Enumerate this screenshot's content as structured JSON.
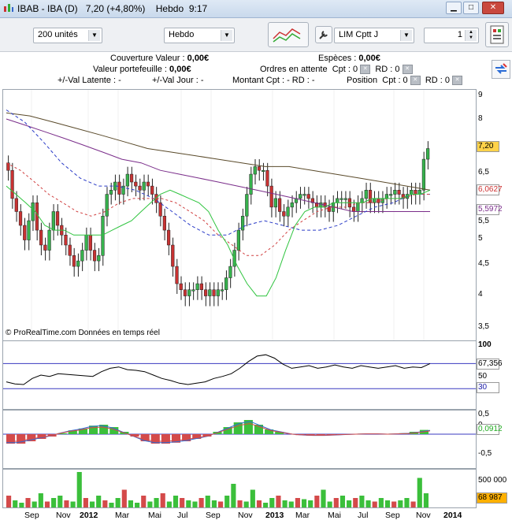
{
  "window": {
    "title_symbol": "IBAB - IBA (D)",
    "title_price": "7,20 (+4,80%)",
    "title_period": "Hebdo",
    "title_time": "9:17"
  },
  "toolbar": {
    "units_select": "200 unités",
    "period_select": "Hebdo",
    "order_type_select": "LIM Cptt J",
    "quantity_value": "1"
  },
  "info": {
    "couverture_label": "Couverture Valeur :",
    "couverture_value": "0,00€",
    "especes_label": "Espèces :",
    "especes_value": "0,00€",
    "portefeuille_label": "Valeur portefeuille :",
    "portefeuille_value": "0,00€",
    "ordres_label": "Ordres en attente",
    "ordres_cpt": "Cpt : 0",
    "ordres_rd": "RD : 0",
    "val_latente": "+/-Val Latente : -",
    "val_jour": "+/-Val Jour : -",
    "montant": "Montant  Cpt : -  RD : -",
    "position_label": "Position",
    "position_cpt": "Cpt : 0",
    "position_rd": "RD : 0"
  },
  "price_axis": {
    "ticks": [
      "9",
      "8",
      "7",
      "6,5",
      "6",
      "5,5",
      "5",
      "4,5",
      "4",
      "3,5"
    ],
    "last_price": "7,20",
    "ma_value_1": "6,0627",
    "ma_value_2": "5,5972",
    "last_price_color": "#ffd24a"
  },
  "rsi_axis": {
    "ticks": [
      "100",
      "50",
      "30"
    ],
    "value": "67,356"
  },
  "macd_axis": {
    "ticks": [
      "0,5",
      "0",
      "-0,5"
    ],
    "value": "0,0912"
  },
  "volume_axis": {
    "ticks": [
      "500 000"
    ],
    "value": "68 987",
    "value_color": "#ffb000"
  },
  "copyright": "© ProRealTime.com  Données en temps réel",
  "x_axis": [
    "Sep",
    "Nov",
    "2012",
    "Mar",
    "Mai",
    "Jul",
    "Sep",
    "Nov",
    "2013",
    "Mar",
    "Mai",
    "Jul",
    "Sep",
    "Nov",
    "2014"
  ],
  "chart_data": {
    "type": "candlestick",
    "y_scale": "log",
    "ylim": [
      3.35,
      9.1
    ],
    "close_last": 7.2,
    "closes": [
      6.6,
      5.9,
      5.6,
      5.3,
      5.0,
      5.4,
      5.8,
      5.2,
      4.9,
      4.8,
      5.2,
      5.6,
      5.3,
      5.1,
      4.9,
      4.7,
      4.5,
      4.6,
      4.8,
      5.1,
      4.8,
      4.6,
      4.7,
      5.5,
      6.0,
      6.1,
      6.3,
      6.0,
      6.2,
      6.5,
      6.3,
      6.2,
      6.1,
      6.3,
      6.2,
      6.0,
      5.8,
      5.5,
      5.2,
      4.9,
      4.5,
      4.2,
      4.1,
      4.0,
      4.1,
      4.1,
      4.2,
      4.1,
      4.0,
      4.1,
      4.0,
      4.1,
      4.1,
      4.3,
      4.5,
      4.8,
      5.2,
      5.5,
      6.0,
      6.5,
      6.7,
      6.6,
      6.6,
      6.2,
      5.7,
      5.9,
      5.6,
      5.5,
      5.7,
      5.8,
      5.9,
      6.0,
      6.0,
      5.9,
      5.8,
      5.7,
      5.8,
      5.7,
      5.6,
      5.8,
      5.9,
      5.9,
      5.9,
      5.7,
      5.6,
      5.8,
      5.9,
      6.1,
      5.8,
      5.9,
      5.8,
      5.9,
      6.0,
      6.0,
      6.1,
      6.0,
      5.9,
      6.0,
      6.1,
      6.0,
      6.1,
      6.9,
      7.2
    ],
    "sma_short": [
      6.2,
      6.0,
      5.8,
      5.6,
      5.3,
      5.2,
      5.2,
      5.1,
      5.1,
      5.1,
      5.1,
      5.2,
      5.3,
      5.4,
      5.6,
      5.8,
      6.0,
      6.1,
      6.0,
      5.9,
      5.8,
      5.6,
      5.2,
      4.9,
      4.5,
      4.2,
      4.0,
      4.0,
      4.3,
      4.8,
      5.3,
      5.6,
      5.7,
      5.7,
      5.8,
      5.8,
      5.8,
      5.8,
      5.9,
      5.9,
      5.9,
      5.9,
      6.0,
      6.0,
      6.1
    ],
    "sma_medium": [
      6.8,
      6.6,
      6.3,
      6.0,
      5.8,
      5.6,
      5.5,
      5.6,
      5.8,
      5.9,
      5.9,
      5.9,
      5.8,
      5.6,
      5.4,
      5.1,
      4.9,
      4.7,
      4.7,
      4.9,
      5.2,
      5.4,
      5.6,
      5.7,
      5.7,
      5.8,
      5.8,
      5.9,
      5.9,
      6.0,
      6.0
    ],
    "sma_long": [
      8.4,
      8.0,
      7.4,
      6.8,
      6.4,
      6.2,
      6.2,
      6.1,
      5.9,
      5.6,
      5.3,
      5.1,
      5.1,
      5.3,
      5.4,
      5.3,
      5.2,
      5.2,
      5.3,
      5.5,
      5.7,
      5.8,
      6.0,
      6.0
    ],
    "sma_200": [
      8.1,
      7.9,
      7.7,
      7.5,
      7.3,
      7.1,
      6.9,
      6.8,
      6.6,
      6.5,
      6.4,
      6.3,
      6.2,
      6.1,
      6.0,
      5.9,
      5.8,
      5.7,
      5.6,
      5.6,
      5.6,
      5.6,
      5.6
    ],
    "sma_slow": [
      8.3,
      8.2,
      8.0,
      7.8,
      7.6,
      7.4,
      7.2,
      7.1,
      7.0,
      6.9,
      6.8,
      6.7,
      6.7,
      6.6,
      6.5,
      6.4,
      6.3,
      6.2,
      6.1
    ]
  },
  "rsi_data": [
    40,
    37,
    36,
    45,
    50,
    48,
    52,
    51,
    50,
    49,
    48,
    55,
    60,
    62,
    58,
    57,
    55,
    50,
    45,
    42,
    38,
    36,
    38,
    40,
    45,
    48,
    52,
    60,
    70,
    78,
    80,
    75,
    66,
    60,
    62,
    64,
    60,
    62,
    65,
    62,
    60,
    64,
    62,
    60,
    62,
    64,
    60,
    62,
    61,
    67
  ],
  "macd_hist": [
    -0.2,
    -0.2,
    -0.15,
    -0.1,
    -0.05,
    0.02,
    0.08,
    0.12,
    0.18,
    0.2,
    0.15,
    0.05,
    -0.05,
    -0.15,
    -0.2,
    -0.2,
    -0.18,
    -0.15,
    -0.1,
    -0.05,
    0.05,
    0.15,
    0.25,
    0.3,
    0.2,
    0.1,
    0.05,
    0.0,
    -0.02,
    -0.03,
    -0.03,
    -0.02,
    -0.01,
    0.0,
    0.01,
    0.01,
    0.0,
    0.01,
    0.02,
    0.05,
    0.09
  ],
  "volume_data": [
    0.1,
    0.06,
    0.04,
    0.08,
    0.05,
    0.12,
    0.05,
    0.08,
    0.1,
    0.06,
    0.05,
    0.3,
    0.08,
    0.05,
    0.1,
    0.06,
    0.04,
    0.08,
    0.15,
    0.06,
    0.04,
    0.1,
    0.05,
    0.08,
    0.12,
    0.05,
    0.1,
    0.08,
    0.06,
    0.05,
    0.08,
    0.1,
    0.06,
    0.05,
    0.1,
    0.2,
    0.06,
    0.05,
    0.15,
    0.06,
    0.04,
    0.08,
    0.1,
    0.06,
    0.05,
    0.08,
    0.07,
    0.06,
    0.1,
    0.15,
    0.05,
    0.08,
    0.1,
    0.06,
    0.08,
    0.1,
    0.06,
    0.05,
    0.08,
    0.06,
    0.05,
    0.06,
    0.08,
    0.05,
    0.25,
    0.12
  ]
}
